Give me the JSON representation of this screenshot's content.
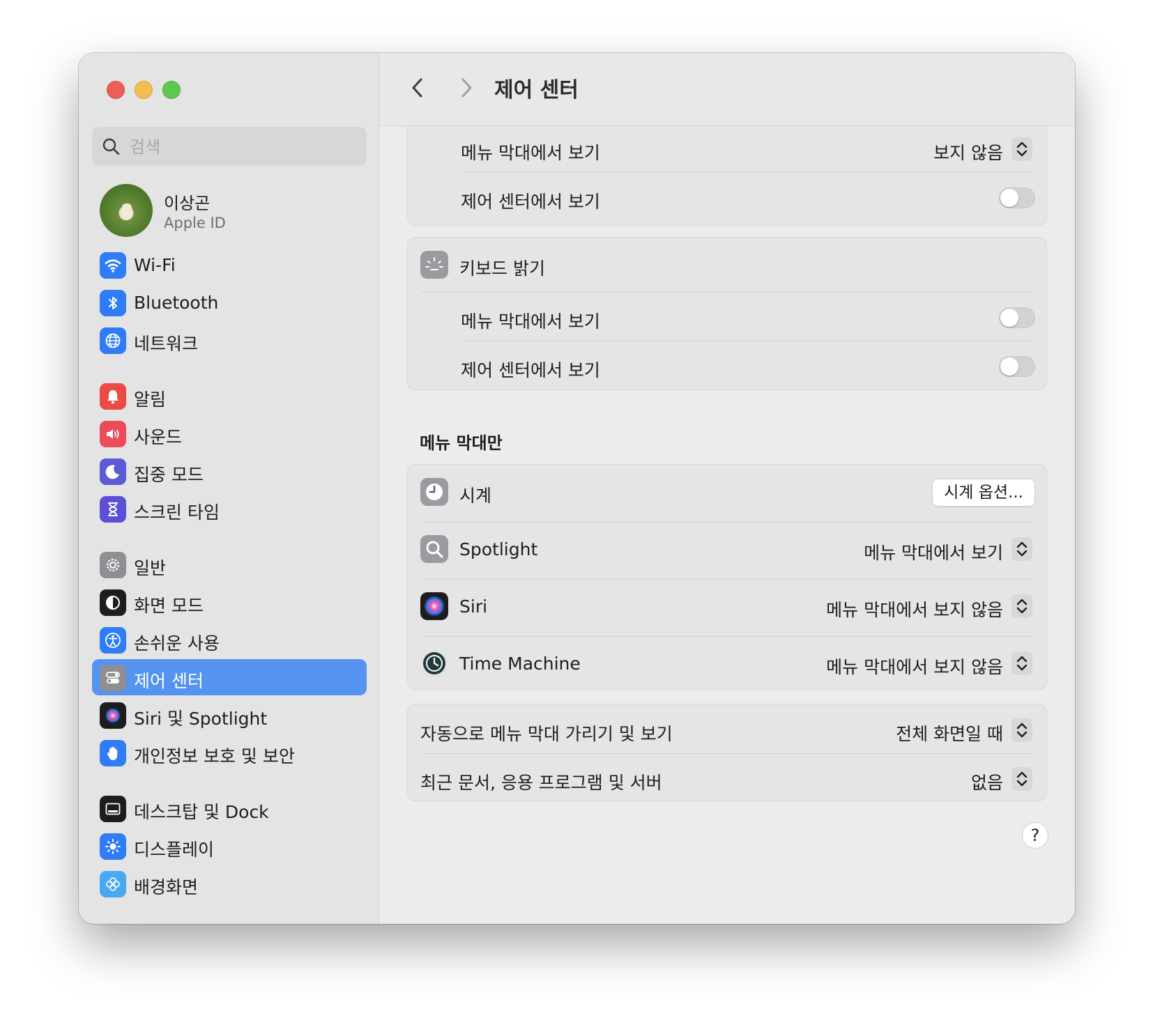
{
  "window": {
    "title": "제어 센터"
  },
  "search": {
    "placeholder": "검색"
  },
  "profile": {
    "name": "이상곤",
    "subtitle": "Apple ID"
  },
  "sidebar": {
    "items": [
      {
        "label": "Wi-Fi",
        "icon": "wifi-icon",
        "color": "#2f7cf6"
      },
      {
        "label": "Bluetooth",
        "icon": "bluetooth-icon",
        "color": "#2f7cf6"
      },
      {
        "label": "네트워크",
        "icon": "globe-icon",
        "color": "#2f7cf6"
      },
      {
        "label": "알림",
        "icon": "bell-icon",
        "color": "#ec4b45"
      },
      {
        "label": "사운드",
        "icon": "speaker-icon",
        "color": "#ec4b5a"
      },
      {
        "label": "집중 모드",
        "icon": "moon-icon",
        "color": "#5b5bd6"
      },
      {
        "label": "스크린 타임",
        "icon": "hourglass-icon",
        "color": "#5b4fd6"
      },
      {
        "label": "일반",
        "icon": "gear-icon",
        "color": "#8e8e93"
      },
      {
        "label": "화면 모드",
        "icon": "appearance-icon",
        "color": "#1d1d1f"
      },
      {
        "label": "손쉬운 사용",
        "icon": "accessibility-icon",
        "color": "#2f7cf6"
      },
      {
        "label": "제어 센터",
        "icon": "control-center-icon",
        "color": "#8e8e93",
        "active": true
      },
      {
        "label": "Siri 및 Spotlight",
        "icon": "siri-icon",
        "color": "#1d1d1f"
      },
      {
        "label": "개인정보 보호 및 보안",
        "icon": "hand-icon",
        "color": "#2f7cf6"
      },
      {
        "label": "데스크탑 및 Dock",
        "icon": "dock-icon",
        "color": "#1d1d1f"
      },
      {
        "label": "디스플레이",
        "icon": "sun-icon",
        "color": "#2f7cf6"
      },
      {
        "label": "배경화면",
        "icon": "flower-icon",
        "color": "#4aa8f0"
      }
    ]
  },
  "main": {
    "card1": {
      "rows": [
        {
          "label": "메뉴 막대에서 보기",
          "value": "보지 않음"
        },
        {
          "label": "제어 센터에서 보기",
          "toggle": false
        }
      ]
    },
    "card2": {
      "header": "키보드 밝기",
      "icon": "keyboard-brightness-icon",
      "rows": [
        {
          "label": "메뉴 막대에서 보기",
          "toggle": false
        },
        {
          "label": "제어 센터에서 보기",
          "toggle": false
        }
      ]
    },
    "section_menubar_only": "메뉴 막대만",
    "card3": {
      "rows": [
        {
          "label": "시계",
          "icon": "clock-icon",
          "button": "시계 옵션..."
        },
        {
          "label": "Spotlight",
          "icon": "spotlight-icon",
          "value": "메뉴 막대에서 보기"
        },
        {
          "label": "Siri",
          "icon": "siri-icon",
          "value": "메뉴 막대에서 보지 않음"
        },
        {
          "label": "Time Machine",
          "icon": "time-machine-icon",
          "value": "메뉴 막대에서 보지 않음"
        }
      ]
    },
    "card4": {
      "rows": [
        {
          "label": "자동으로 메뉴 막대 가리기 및 보기",
          "value": "전체 화면일 때"
        },
        {
          "label": "최근 문서, 응용 프로그램 및 서버",
          "value": "없음"
        }
      ]
    },
    "help_label": "?"
  },
  "colors": {
    "accent": "#5593f1",
    "traffic_red": "#ec5f58",
    "traffic_yellow": "#f4bd4f",
    "traffic_green": "#5dc84f"
  }
}
